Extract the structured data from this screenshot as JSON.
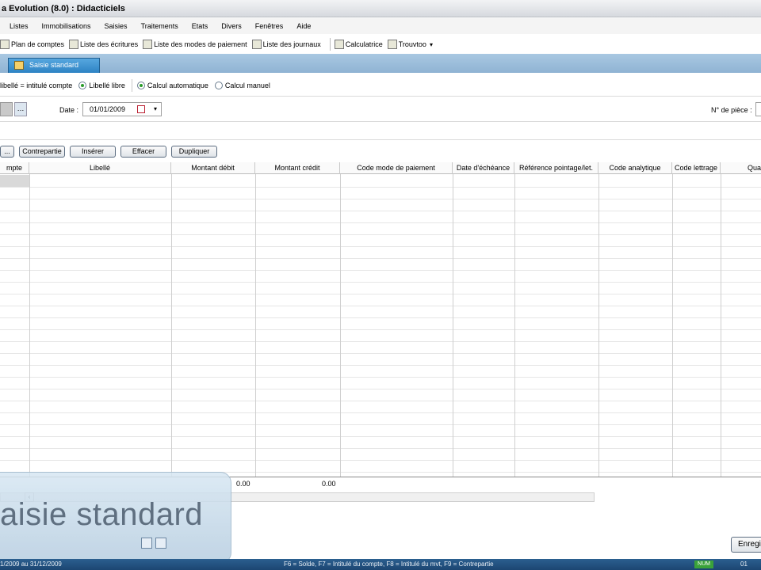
{
  "window": {
    "title": "a Evolution (8.0) : Didacticiels"
  },
  "menu": [
    "Listes",
    "Immobilisations",
    "Saisies",
    "Traitements",
    "Etats",
    "Divers",
    "Fenêtres",
    "Aide"
  ],
  "toolbar": [
    {
      "label": "Plan de comptes",
      "icon": "chart-of-accounts-icon"
    },
    {
      "label": "Liste des écritures",
      "icon": "entries-list-icon"
    },
    {
      "label": "Liste des modes de paiement",
      "icon": "payment-modes-icon"
    },
    {
      "label": "Liste des journaux",
      "icon": "journals-icon"
    },
    {
      "label": "Calculatrice",
      "icon": "calculator-icon"
    },
    {
      "label": "Trouvtoo",
      "icon": "search-tool-icon"
    }
  ],
  "tab": {
    "label": "Saisie standard"
  },
  "options": {
    "libelle_intitule": "libellé = intitulé compte",
    "libelle_libre": "Libellé libre",
    "calcul_auto": "Calcul automatique",
    "calcul_manuel": "Calcul manuel"
  },
  "date": {
    "label": "Date :",
    "value": "01/01/2009"
  },
  "piece": {
    "label": "N° de pièce :"
  },
  "actions": [
    "...",
    "Contrepartie",
    "Insérer",
    "Effacer",
    "Dupliquer"
  ],
  "grid": {
    "columns": [
      "mpte",
      "Libellé",
      "Montant débit",
      "Montant crédit",
      "Code mode de paiement",
      "Date d'échéance",
      "Référence pointage/let.",
      "Code analytique",
      "Code lettrage",
      "Qua"
    ],
    "totals": {
      "debit": "0.00",
      "credit": "0.00"
    }
  },
  "overlay": {
    "text": "aisie standard"
  },
  "save_button": "Enregi",
  "status": {
    "left": "1/2009 au 31/12/2009",
    "middle": "F6 = Solde, F7 = Intitulé du compte, F8 = Intitulé du mvt, F9 = Contrepartie",
    "num": "NUM",
    "right": "01"
  },
  "colors": {
    "tab_blue": "#2d83c4",
    "status_blue": "#1c4672",
    "radio_green": "#2a9b2a"
  }
}
